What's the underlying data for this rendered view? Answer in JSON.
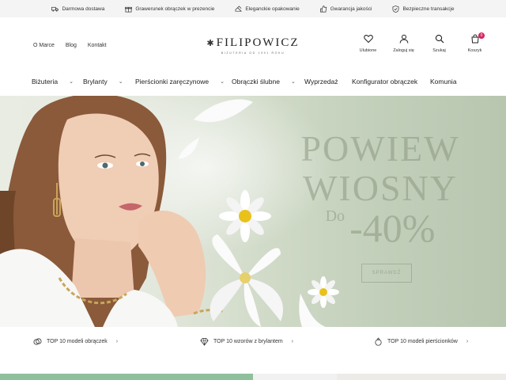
{
  "perks": [
    {
      "icon": "truck-icon",
      "label": "Darmowa dostawa"
    },
    {
      "icon": "gift-icon",
      "label": "Grawerunek obrączek w prezencie"
    },
    {
      "icon": "package-icon",
      "label": "Eleganckie opakowanie"
    },
    {
      "icon": "thumbs-up-icon",
      "label": "Gwarancja jakości"
    },
    {
      "icon": "shield-check-icon",
      "label": "Bezpieczne transakcje"
    }
  ],
  "header": {
    "links": [
      "O Marce",
      "Blog",
      "Kontakt"
    ],
    "logo": {
      "main": "FILIPOWICZ",
      "sub": "BIŻUTERIA OD 1991 ROKU"
    },
    "actions": [
      {
        "icon": "heart-icon",
        "label": "Ulubione"
      },
      {
        "icon": "user-icon",
        "label": "Zaloguj się"
      },
      {
        "icon": "search-icon",
        "label": "Szukaj"
      },
      {
        "icon": "bag-icon",
        "label": "Koszyk",
        "count": "0"
      }
    ]
  },
  "nav": [
    {
      "label": "Biżuteria",
      "dropdown": true
    },
    {
      "label": "Brylanty",
      "dropdown": true
    },
    {
      "label": "Pierścionki zaręczynowe",
      "dropdown": true
    },
    {
      "label": "Obrączki ślubne",
      "dropdown": true
    },
    {
      "label": "Wyprzedaż",
      "dropdown": false
    },
    {
      "label": "Konfigurator obrączek",
      "dropdown": false
    },
    {
      "label": "Komunia",
      "dropdown": false
    }
  ],
  "hero": {
    "line1": "POWIEW",
    "line2": "WIOSNY",
    "prefix": "Do",
    "discount": "-40%",
    "button": "SPRAWDŹ"
  },
  "tops": [
    {
      "icon": "rings-icon",
      "label": "TOP 10 modeli obrączek"
    },
    {
      "icon": "diamond-icon",
      "label": "TOP 10 wzorów z brylantem"
    },
    {
      "icon": "ring-icon",
      "label": "TOP 10 modeli pierścionków"
    }
  ],
  "colors": {
    "accent": "#d6245f",
    "hero_text": "#8c9880"
  }
}
